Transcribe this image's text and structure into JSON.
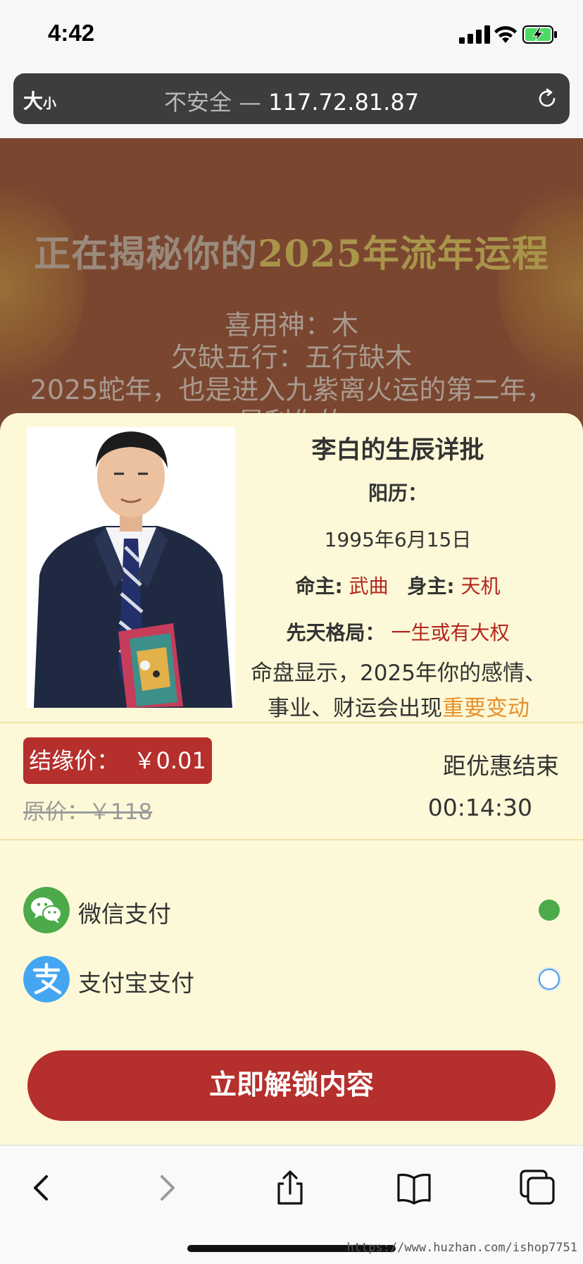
{
  "status_bar": {
    "time": "4:42"
  },
  "browser": {
    "text_size_label": "大",
    "text_size_small": "小",
    "insecure_label": "不安全 —",
    "address": "117.72.81.87"
  },
  "hero": {
    "title_part1": "正在揭秘你的",
    "title_part2": "2025年流年运程",
    "line1": "喜用神：木",
    "line2": "欠缺五行：五行缺木",
    "line3": "2025蛇年，也是进入九紫离火运的第二年，",
    "line4": "是利你的"
  },
  "detail": {
    "title": "李白的生辰详批",
    "solar_label": "阳历：",
    "solar_date": "1995年6月15日",
    "ming_label": "命主:",
    "ming_value": "武曲",
    "shen_label": "身主:",
    "shen_value": "天机",
    "pattern_label": "先天格局：",
    "pattern_value": "一生或有大权",
    "summary_text": "命盘显示，2025年你的感情、事业、财运会出现",
    "summary_highlight": "重要变动"
  },
  "pricing": {
    "price_label": "结缘价：",
    "price_value": "￥0.01",
    "original_label": "原价：",
    "original_value": "￥118",
    "countdown_label": "距优惠结束",
    "countdown_value": "00:14:30"
  },
  "payment": {
    "options": [
      {
        "label": "微信支付",
        "selected": true,
        "icon": "wechat-icon",
        "color": "#4caa4a"
      },
      {
        "label": "支付宝支付",
        "selected": false,
        "icon": "alipay-icon",
        "color": "#44a6f0"
      }
    ]
  },
  "cta": {
    "label": "立即解锁内容"
  },
  "watermark": "https://www.huzhan.com/ishop7751",
  "colors": {
    "accent_red": "#b52f2c",
    "highlight_orange": "#e6912e",
    "sheet_bg": "#fdf9d8"
  }
}
